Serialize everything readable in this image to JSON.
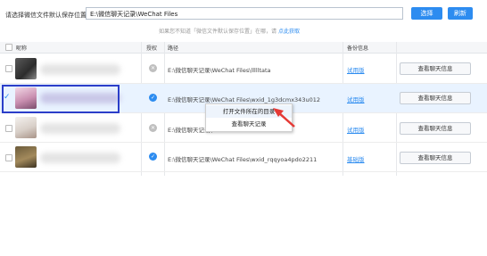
{
  "toolbar": {
    "path_label": "请选择微信文件默认保存位置",
    "path_value": "E:\\微信聊天记录\\WeChat Files",
    "select_label": "选择",
    "refresh_label": "刷新",
    "hint_text": "如果您不知道「微信文件默认保存位置」在哪，请",
    "hint_link": "点此获取"
  },
  "table": {
    "headers": [
      "昵称",
      "授权",
      "路径",
      "备份信息"
    ],
    "rows": [
      {
        "path": "E:\\微信聊天记录\\WeChat Files\\llllltata",
        "backup": "试用版",
        "status": "off",
        "selected": false
      },
      {
        "path": "E:\\微信聊天记录\\WeChat Files\\wxid_1g3dcmx343u012",
        "backup": "试用版",
        "status": "on",
        "selected": true
      },
      {
        "path": "E:\\微信聊天记录\\...0155d12",
        "backup": "试用版",
        "status": "off",
        "selected": false
      },
      {
        "path": "E:\\微信聊天记录\\WeChat Files\\wxid_rqqyoa4pdo2211",
        "backup": "基础版",
        "status": "on",
        "selected": false
      }
    ],
    "view_button": "查看聊天信息"
  },
  "context_menu": {
    "items": [
      "打开文件所在的目录",
      "查看聊天记录"
    ]
  },
  "colors": {
    "accent": "#2d8cf0",
    "annotation_box": "#2b3ec9",
    "annotation_arrow": "#e53935"
  }
}
